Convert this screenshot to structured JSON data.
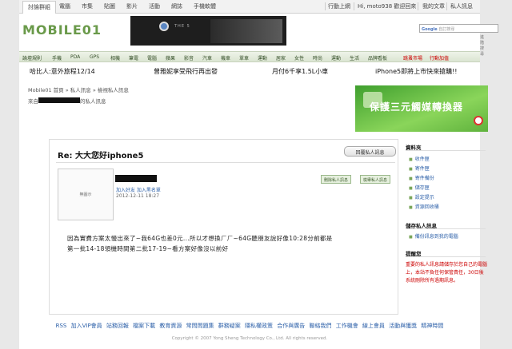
{
  "nav": {
    "tabs": [
      "討論群組",
      "電腦",
      "市集",
      "貼圖",
      "影片",
      "活動",
      "網誌",
      "手機軟體"
    ],
    "right": [
      "行動上網",
      "Hi, moto938 歡迎回來",
      "我的文章",
      "私人訊息",
      "登出"
    ]
  },
  "header": {
    "logo": "MOBILE01",
    "banner_brand": "THE 5",
    "search_placeholder": "自訂搜尋",
    "search_google": "Google",
    "search_advanced": "進階搜尋"
  },
  "categories": [
    "論壇規則",
    "手機",
    "PDA",
    "GPS",
    "相機",
    "筆電",
    "電腦",
    "蘋果",
    "影音",
    "汽車",
    "機車",
    "單車",
    "運動",
    "居家",
    "女性",
    "時尚",
    "運動",
    "生活",
    "品牌看板",
    "跳蚤市場",
    "行動加值"
  ],
  "news": [
    "哈比人:意外旅程12/14",
    "曾雅妮享受飛行再出發",
    "月付6千享1.5L小車",
    "iPhone5即將上市快來搶購!!"
  ],
  "breadcrumb": "Mobile01 首頁 » 私人訊息 » 檢視私人訊息",
  "from_prefix": "來自",
  "from_suffix": "的私人訊息",
  "ad": {
    "text": "保護三元觸媒轉換器"
  },
  "message": {
    "subject": "Re: 大大您好iphone5",
    "reply_button": "回覆私人訊息",
    "avatar_text": "無圖示",
    "user_links": "加入好友  加入黑名單",
    "date": "2012-12-11 18:27",
    "delete_button": "刪除私人訊息",
    "report_button": "檢舉私人訊息",
    "body_line1": "因為實費方案太慢出來了~我64G也差0元...所以才想換ㄏㄏ~64G聽朋友說好像10:28分前都是",
    "body_line2": "第一批14-18領機時間第二批17-19~看方案好像沒以前好"
  },
  "sidebar": {
    "folders_title": "資料夾",
    "folders": [
      "收件匣",
      "寄件匣",
      "寄件備份",
      "儲存匣",
      "設定提示",
      "資源回收桶"
    ],
    "save_title": "儲存私人訊息",
    "save_items": [
      "備份訊息到我的電腦"
    ],
    "reminder_title": "提醒您",
    "reminder_text": "重要的私人訊息請儲存於您自己的電腦上，本站不負任何保管責任，30日後系統刪除所有過期訊息。"
  },
  "footer": {
    "links": "RSS  加入VIP會員  站務回報  檔案下載  教育資源  常問問題集  群務疑案  隱私權政策  合作與廣告  聯絡我們  工作機會  線上會員  活動與獲獎  精神時間",
    "copyright": "Copyright © 2007 Yong Sheng Technology Co., Ltd. All rights reserved."
  }
}
